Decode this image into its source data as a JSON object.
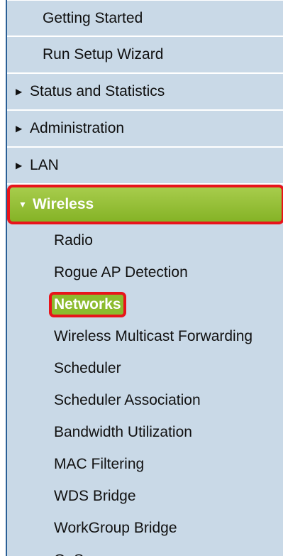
{
  "nav": {
    "sections": [
      {
        "label": "Getting Started",
        "arrow": ""
      },
      {
        "label": "Run Setup Wizard",
        "arrow": ""
      },
      {
        "label": "Status and Statistics",
        "arrow": "▶"
      },
      {
        "label": "Administration",
        "arrow": "▶"
      },
      {
        "label": "LAN",
        "arrow": "▶"
      },
      {
        "label": "Wireless",
        "arrow": "▼"
      }
    ],
    "wireless_items": [
      "Radio",
      "Rogue AP Detection",
      "Networks",
      "Wireless Multicast Forwarding",
      "Scheduler",
      "Scheduler Association",
      "Bandwidth Utilization",
      "MAC Filtering",
      "WDS Bridge",
      "WorkGroup Bridge",
      "QoS"
    ]
  },
  "colors": {
    "panel": "#c9d9e7",
    "active_green": "#8cbb2e",
    "highlight_red": "#e8141b",
    "edge_blue": "#2a5f96"
  }
}
